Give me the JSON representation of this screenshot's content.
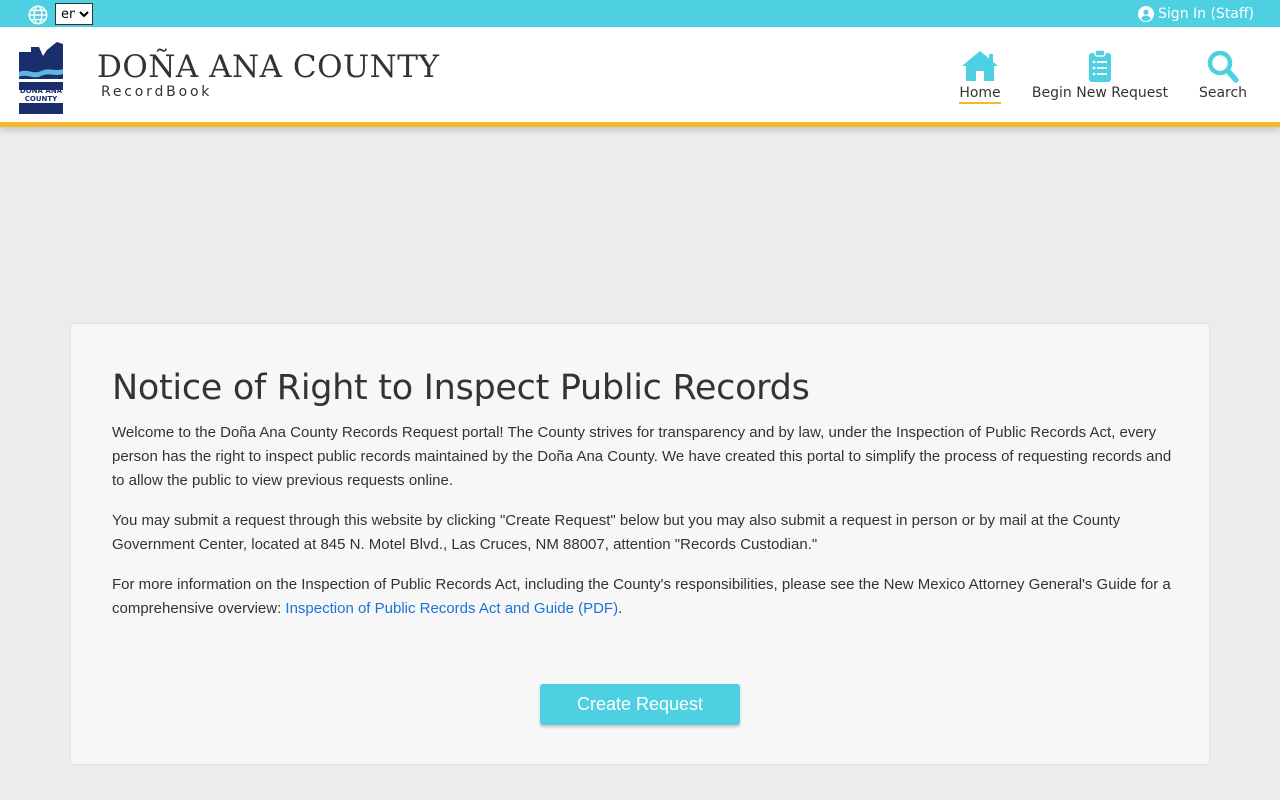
{
  "topbar": {
    "language_value": "en",
    "language_options": [
      "en"
    ],
    "signin_label": "Sign In (Staff)",
    "bg_color": "#4dd0e1"
  },
  "header": {
    "logo_text": "DOÑA ANA COUNTY",
    "title": "DOÑA ANA COUNTY",
    "subtitle": "RecordBook",
    "accent_color": "#f5b82e"
  },
  "nav": {
    "items": [
      {
        "label": "Home",
        "icon": "home-icon",
        "active": true
      },
      {
        "label": "Begin New Request",
        "icon": "clipboard-icon",
        "active": false
      },
      {
        "label": "Search",
        "icon": "search-icon",
        "active": false
      }
    ]
  },
  "notice": {
    "heading": "Notice of Right to Inspect Public Records",
    "para1": "Welcome to the Doña Ana County Records Request portal! The County strives for transparency and by law, under the Inspection of Public Records Act, every person has the right to inspect public records maintained by the Doña Ana County. We have created this portal to simplify the process of requesting records and to allow the public to view previous requests online.",
    "para2": "You may submit a request through this website by clicking \"Create Request\" below but you may also submit a request in person or by mail at the County Government Center, located at 845 N. Motel Blvd., Las Cruces, NM 88007, attention \"Records Custodian.\"",
    "para3_text": "For more information on the Inspection of Public Records Act, including the County's responsibilities, please see the New Mexico Attorney General's Guide for a comprehensive overview: ",
    "para3_link": "Inspection of Public Records Act and Guide (PDF)",
    "para3_end": ".",
    "button_label": "Create Request"
  }
}
